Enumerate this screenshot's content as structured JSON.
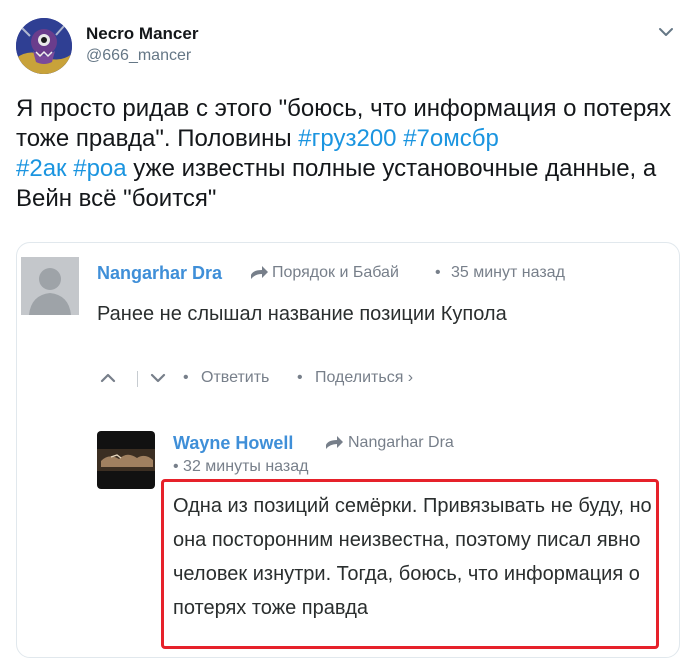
{
  "author": {
    "name": "Necro Mancer",
    "handle": "@666_mancer",
    "avatar_icon": "necromancer-avatar-icon"
  },
  "tweet": {
    "text_parts": [
      {
        "text": "Я просто ридав с этого \"боюсь, что информация о потерях тоже правда\". Половины ",
        "type": "text"
      },
      {
        "text": "#груз200",
        "type": "hashtag"
      },
      {
        "text": " ",
        "type": "text"
      },
      {
        "text": "#7омсбр",
        "type": "hashtag"
      },
      {
        "text": " ",
        "type": "text"
      },
      {
        "text": "#2ак",
        "type": "hashtag"
      },
      {
        "text": " ",
        "type": "text"
      },
      {
        "text": "#роа",
        "type": "hashtag"
      },
      {
        "text": " уже известны полные установочные данные, а Вейн всё \"боится\"",
        "type": "text"
      }
    ]
  },
  "embedded_comment": {
    "first": {
      "author": "Nangarhar Dra",
      "reply_to": "Порядок и Бабай",
      "separator": "•",
      "time": "35 минут назад",
      "body": "Ранее не слышал название позиции Купола",
      "actions": {
        "separator": "•",
        "reply": "Ответить",
        "share": "Поделиться ›"
      }
    },
    "second": {
      "author": "Wayne Howell",
      "reply_to": "Nangarhar Dra",
      "time": "• 32 минуты назад",
      "body": "Одна из позиций семёрки. Привязывать не буду, но она посторонним неизвестна, поэтому писал явно человек изнутри. Тогда, боюсь, что информация о потерях тоже правда",
      "highlight_color": "#e6212a"
    }
  },
  "colors": {
    "hashtag": "#1b95e0",
    "comment_author": "#3f8fd8",
    "meta_gray": "#777f8a"
  }
}
